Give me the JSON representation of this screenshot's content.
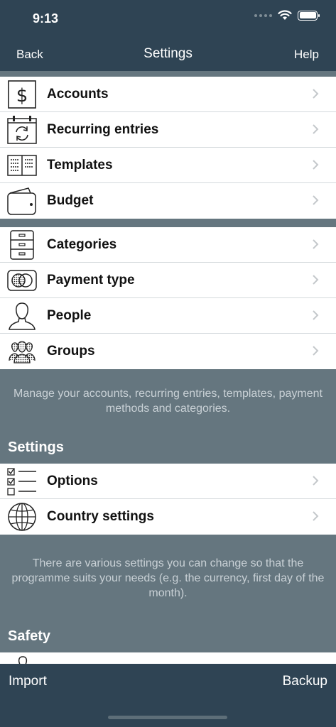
{
  "status_bar": {
    "time": "9:13"
  },
  "nav": {
    "back_label": "Back",
    "title": "Settings",
    "help_label": "Help"
  },
  "group1": [
    {
      "label": "Accounts",
      "icon": "dollar-icon"
    },
    {
      "label": "Recurring entries",
      "icon": "calendar-refresh-icon"
    },
    {
      "label": "Templates",
      "icon": "template-book-icon"
    },
    {
      "label": "Budget",
      "icon": "wallet-icon"
    }
  ],
  "group2": [
    {
      "label": "Categories",
      "icon": "cabinet-icon"
    },
    {
      "label": "Payment type",
      "icon": "credit-card-icon"
    },
    {
      "label": "People",
      "icon": "person-icon"
    },
    {
      "label": "Groups",
      "icon": "group-icon"
    }
  ],
  "note1": "Manage your accounts, recurring entries, templates, payment methods and categories.",
  "settings_section": {
    "header": "Settings",
    "rows": [
      {
        "label": "Options",
        "icon": "checklist-icon"
      },
      {
        "label": "Country settings",
        "icon": "globe-icon"
      }
    ],
    "note": "There are various settings you can change so that the programme suits your needs (e.g. the currency, first day of the month)."
  },
  "safety_section": {
    "header": "Safety"
  },
  "toolbar": {
    "import_label": "Import",
    "backup_label": "Backup"
  }
}
